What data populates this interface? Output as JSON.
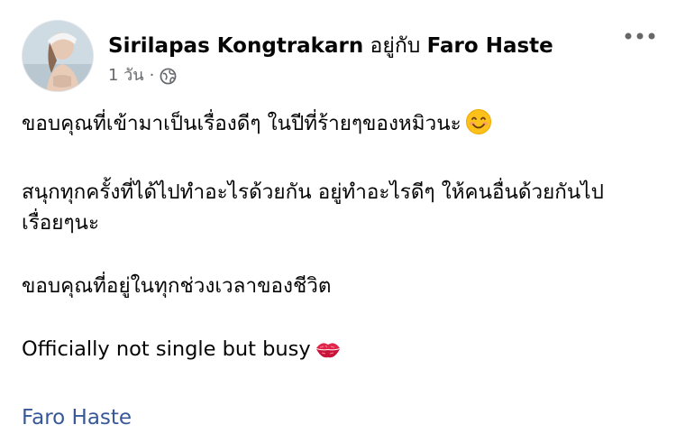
{
  "post": {
    "author": "Sirilapas Kongtrakarn",
    "with_word": "อยู่กับ",
    "tagged_person": "Faro Haste",
    "time": "1 วัน",
    "separator": "·",
    "audience_icon": "globe-icon",
    "more_icon": "more-options-icon",
    "paragraphs": [
      {
        "text": "ขอบคุณที่เข้ามาเป็นเรื่องดีๆ ในปีที่ร้ายๆของหมิวนะ",
        "emoji": "smiling-face-icon"
      },
      {
        "text": "สนุกทุกครั้งที่ได้ไปทำอะไรด้วยกัน อยู่ทำอะไรดีๆ ให้คนอื่นด้วยกันไป"
      },
      {
        "text": "เรื่อยๆนะ"
      },
      {
        "text": "ขอบคุณที่อยู่ในทุกช่วงเวลาของชีวิต"
      },
      {
        "text": "Officially not single but busy",
        "emoji": "kiss-mark-icon"
      }
    ],
    "tag_link": "Faro Haste"
  },
  "colors": {
    "text": "#050505",
    "secondary": "#65676b",
    "link": "#385898"
  }
}
